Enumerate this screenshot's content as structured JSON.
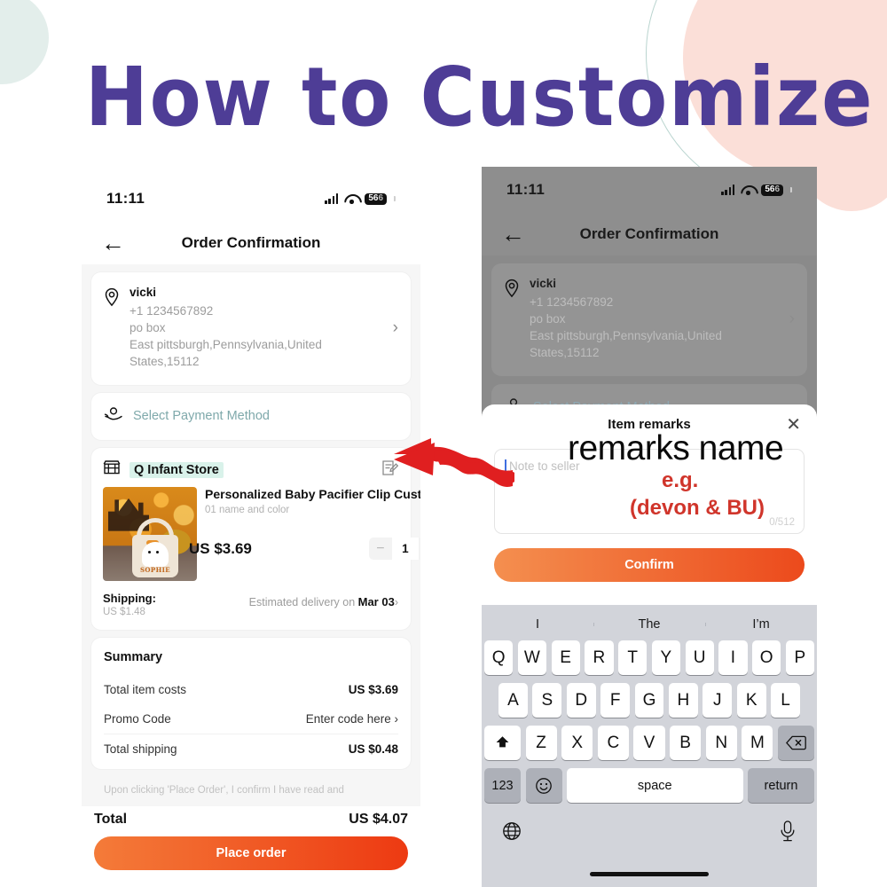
{
  "title": "How to Customize",
  "colors": {
    "title_purple": "#4e3d96",
    "accent_orange": "#ed3a12",
    "annotation_red": "#d0352b",
    "store_highlight": "#d9f2ea",
    "payment_teal": "#7fa9ab",
    "deco_mint": "#e3eeeb",
    "deco_pink": "#fbdfd8"
  },
  "left_phone": {
    "status": {
      "time": "11:11",
      "battery": "56",
      "signal_icon": "cellular-bars-icon",
      "wifi_icon": "wifi-icon"
    },
    "nav": {
      "back_icon": "back-arrow-icon",
      "title": "Order Confirmation"
    },
    "address": {
      "pin_icon": "location-pin-icon",
      "name": "vicki",
      "phone": "+1 1234567892",
      "line1": "po box",
      "line2": "East pittsburgh,Pennsylvania,United",
      "line3": "States,15112",
      "chevron": "›"
    },
    "payment": {
      "icon": "payment-hand-coin-icon",
      "label": "Select Payment Method"
    },
    "store": {
      "icon": "storefront-icon",
      "name": "Q Infant Store",
      "remark_icon": "edit-note-icon"
    },
    "product": {
      "thumb_alt": "halloween-ghost-bucket-photo",
      "thumb_word": "SOPHIE",
      "title": "Personalized Baby Pacifier Clip Custo…",
      "variant": "01 name and color",
      "price": "US $3.69",
      "qty": "1",
      "minus": "−",
      "plus": "+"
    },
    "shipping": {
      "label": "Shipping:",
      "cost": "US $1.48",
      "estimate_prefix": "Estimated delivery on ",
      "estimate_date": "Mar 03",
      "chevron": "›"
    },
    "summary": {
      "title": "Summary",
      "rows": [
        {
          "label": "Total item costs",
          "value": "US $3.69"
        },
        {
          "label": "Promo Code",
          "value": "Enter code here ›"
        },
        {
          "label": "Total shipping",
          "value": "US $0.48"
        }
      ]
    },
    "disclaimer": "Upon clicking 'Place Order', I confirm I have read and",
    "footer": {
      "total_label": "Total",
      "total_value": "US $4.07",
      "cta": "Place order"
    }
  },
  "right_phone": {
    "status": {
      "time": "11:11",
      "battery": "56"
    },
    "nav": {
      "title": "Order Confirmation"
    },
    "address": {
      "name": "vicki",
      "phone": "+1 1234567892",
      "line1": "po box",
      "line2": "East pittsburgh,Pennsylvania,United",
      "line3": "States,15112",
      "chevron": "›"
    },
    "payment": {
      "label": "Select Payment Method"
    },
    "sheet": {
      "title": "Item remarks",
      "close_icon": "close-x-icon",
      "placeholder": "Note to seller",
      "counter": "0/512",
      "confirm": "Confirm"
    },
    "annotations": {
      "remarks_name": "remarks name",
      "eg": "e.g.",
      "example": "(devon & BU)"
    },
    "keyboard": {
      "predictions": [
        "I",
        "The",
        "I’m"
      ],
      "row1": [
        "Q",
        "W",
        "E",
        "R",
        "T",
        "Y",
        "U",
        "I",
        "O",
        "P"
      ],
      "row2": [
        "A",
        "S",
        "D",
        "F",
        "G",
        "H",
        "J",
        "K",
        "L"
      ],
      "row3": [
        "Z",
        "X",
        "C",
        "V",
        "B",
        "N",
        "M"
      ],
      "shift_icon": "shift-up-arrow-icon",
      "backspace_icon": "backspace-delete-icon",
      "num_key": "123",
      "emoji_icon": "emoji-smiley-icon",
      "space": "space",
      "return": "return",
      "globe_icon": "globe-language-icon",
      "mic_icon": "microphone-icon"
    }
  },
  "annotation_arrow": {
    "icon": "red-wavy-arrow-left-icon"
  }
}
